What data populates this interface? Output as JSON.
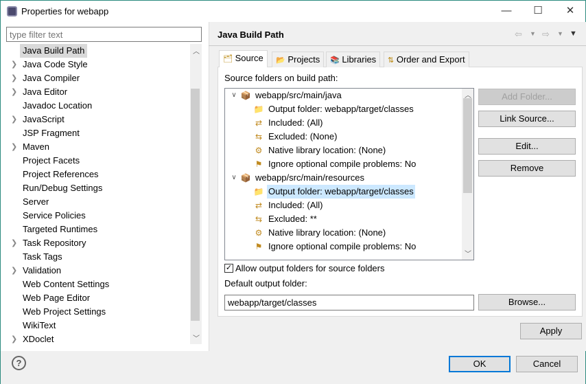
{
  "window": {
    "title": "Properties for webapp",
    "minimize": "—",
    "maximize": "☐",
    "close": "✕"
  },
  "filter": {
    "placeholder": "type filter text"
  },
  "nav": {
    "items": [
      {
        "label": "Java Build Path",
        "expandable": false,
        "selected": true
      },
      {
        "label": "Java Code Style",
        "expandable": true
      },
      {
        "label": "Java Compiler",
        "expandable": true
      },
      {
        "label": "Java Editor",
        "expandable": true
      },
      {
        "label": "Javadoc Location",
        "expandable": false
      },
      {
        "label": "JavaScript",
        "expandable": true
      },
      {
        "label": "JSP Fragment",
        "expandable": false
      },
      {
        "label": "Maven",
        "expandable": true
      },
      {
        "label": "Project Facets",
        "expandable": false
      },
      {
        "label": "Project References",
        "expandable": false
      },
      {
        "label": "Run/Debug Settings",
        "expandable": false
      },
      {
        "label": "Server",
        "expandable": false
      },
      {
        "label": "Service Policies",
        "expandable": false
      },
      {
        "label": "Targeted Runtimes",
        "expandable": false
      },
      {
        "label": "Task Repository",
        "expandable": true
      },
      {
        "label": "Task Tags",
        "expandable": false
      },
      {
        "label": "Validation",
        "expandable": true
      },
      {
        "label": "Web Content Settings",
        "expandable": false
      },
      {
        "label": "Web Page Editor",
        "expandable": false
      },
      {
        "label": "Web Project Settings",
        "expandable": false
      },
      {
        "label": "WikiText",
        "expandable": false
      },
      {
        "label": "XDoclet",
        "expandable": true
      }
    ]
  },
  "page": {
    "title": "Java Build Path"
  },
  "tabs": [
    {
      "label": "Source",
      "icon": "source-folder-icon",
      "active": true
    },
    {
      "label": "Projects",
      "icon": "folder-icon"
    },
    {
      "label": "Libraries",
      "icon": "libraries-icon"
    },
    {
      "label": "Order and Export",
      "icon": "order-export-icon"
    }
  ],
  "source": {
    "tree_label": "Source folders on build path:",
    "rows": [
      {
        "level": 0,
        "text": "webapp/src/main/java",
        "icon": "package-folder-icon"
      },
      {
        "level": 1,
        "text": "Output folder: webapp/target/classes",
        "icon": "output-folder-icon"
      },
      {
        "level": 1,
        "text": "Included: (All)",
        "icon": "inclusion-filter-icon"
      },
      {
        "level": 1,
        "text": "Excluded: (None)",
        "icon": "exclusion-filter-icon"
      },
      {
        "level": 1,
        "text": "Native library location: (None)",
        "icon": "native-library-icon"
      },
      {
        "level": 1,
        "text": "Ignore optional compile problems: No",
        "icon": "ignore-problems-icon"
      },
      {
        "level": 0,
        "text": "webapp/src/main/resources",
        "icon": "package-folder-icon"
      },
      {
        "level": 1,
        "text": "Output folder: webapp/target/classes",
        "icon": "output-folder-icon",
        "highlighted": true
      },
      {
        "level": 1,
        "text": "Included: (All)",
        "icon": "inclusion-filter-icon"
      },
      {
        "level": 1,
        "text": "Excluded: **",
        "icon": "exclusion-filter-icon"
      },
      {
        "level": 1,
        "text": "Native library location: (None)",
        "icon": "native-library-icon"
      },
      {
        "level": 1,
        "text": "Ignore optional compile problems: No",
        "icon": "ignore-problems-icon"
      }
    ],
    "buttons": {
      "add_folder": "Add Folder...",
      "link_source": "Link Source...",
      "edit": "Edit...",
      "remove": "Remove"
    },
    "allow_output_label": "Allow output folders for source folders",
    "allow_output_checked": true,
    "default_output_label": "Default output folder:",
    "default_output_value": "webapp/target/classes",
    "browse": "Browse..."
  },
  "apply": "Apply",
  "ok": "OK",
  "cancel": "Cancel",
  "help": "?"
}
